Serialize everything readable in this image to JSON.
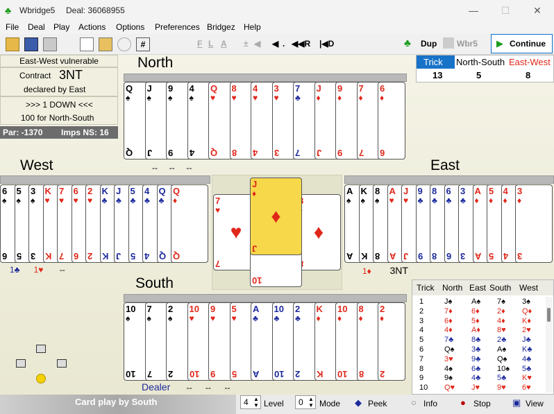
{
  "window": {
    "app_title": "Wbridge5",
    "deal_label": "Deal: 36068955",
    "minimize": "—",
    "maximize": "☐",
    "close": "✕"
  },
  "menu": [
    "File",
    "Deal",
    "Play",
    "Actions",
    "Options",
    "Preferences",
    "Bridgez",
    "Help"
  ],
  "toolbar": {
    "nav": [
      "F",
      "L",
      "A",
      "±",
      "◀",
      ".",
      "◀◀R",
      "|◀D"
    ],
    "dup": "Dup",
    "wbr5": "Wbr5",
    "continue": "Continue"
  },
  "info": {
    "vulnerable": "East-West vulnerable",
    "contract_label": "Contract",
    "contract": "3NT",
    "declared": "declared by East",
    "result": ">>> 1 DOWN <<<",
    "points": "100 for North-South",
    "par": "Par: -1370",
    "imps": "Imps NS: 16"
  },
  "score": {
    "headers": [
      "Trick",
      "North-South",
      "East-West"
    ],
    "values": [
      "13",
      "5",
      "8"
    ],
    "header_colors": [
      "#ffffff",
      "#000000",
      "#e0271a"
    ]
  },
  "directions": {
    "north": "North",
    "south": "South",
    "west": "West",
    "east": "East"
  },
  "auction": {
    "north_below": [
      "--",
      "--",
      "--"
    ],
    "west_below": [
      "1♣",
      "1♥",
      "--"
    ],
    "east_below": [
      "1♦",
      "3NT"
    ],
    "south_below": [
      "Dealer",
      "--",
      "--",
      "--"
    ]
  },
  "hands": {
    "north": [
      {
        "r": "Q",
        "s": "♠",
        "c": "blk"
      },
      {
        "r": "J",
        "s": "♠",
        "c": "blk"
      },
      {
        "r": "9",
        "s": "♠",
        "c": "blk"
      },
      {
        "r": "4",
        "s": "♠",
        "c": "blk"
      },
      {
        "r": "Q",
        "s": "♥",
        "c": "red"
      },
      {
        "r": "8",
        "s": "♥",
        "c": "red"
      },
      {
        "r": "4",
        "s": "♥",
        "c": "red"
      },
      {
        "r": "3",
        "s": "♥",
        "c": "red"
      },
      {
        "r": "7",
        "s": "♣",
        "c": "blu"
      },
      {
        "r": "J",
        "s": "♦",
        "c": "red"
      },
      {
        "r": "9",
        "s": "♦",
        "c": "red"
      },
      {
        "r": "7",
        "s": "♦",
        "c": "red"
      },
      {
        "r": "6",
        "s": "♦",
        "c": "red"
      }
    ],
    "west": [
      {
        "r": "6",
        "s": "♠",
        "c": "blk"
      },
      {
        "r": "5",
        "s": "♠",
        "c": "blk"
      },
      {
        "r": "3",
        "s": "♠",
        "c": "blk"
      },
      {
        "r": "K",
        "s": "♥",
        "c": "red"
      },
      {
        "r": "7",
        "s": "♥",
        "c": "red"
      },
      {
        "r": "6",
        "s": "♥",
        "c": "red"
      },
      {
        "r": "2",
        "s": "♥",
        "c": "red"
      },
      {
        "r": "K",
        "s": "♣",
        "c": "blu"
      },
      {
        "r": "J",
        "s": "♣",
        "c": "blu"
      },
      {
        "r": "5",
        "s": "♣",
        "c": "blu"
      },
      {
        "r": "4",
        "s": "♣",
        "c": "blu"
      },
      {
        "r": "Q",
        "s": "♣",
        "c": "blu"
      },
      {
        "r": "Q",
        "s": "♦",
        "c": "red"
      }
    ],
    "east": [
      {
        "r": "A",
        "s": "♠",
        "c": "blk"
      },
      {
        "r": "K",
        "s": "♠",
        "c": "blk"
      },
      {
        "r": "8",
        "s": "♠",
        "c": "blk"
      },
      {
        "r": "A",
        "s": "♥",
        "c": "red"
      },
      {
        "r": "J",
        "s": "♥",
        "c": "red"
      },
      {
        "r": "9",
        "s": "♣",
        "c": "blu"
      },
      {
        "r": "8",
        "s": "♣",
        "c": "blu"
      },
      {
        "r": "6",
        "s": "♣",
        "c": "blu"
      },
      {
        "r": "3",
        "s": "♣",
        "c": "blu"
      },
      {
        "r": "A",
        "s": "♦",
        "c": "red"
      },
      {
        "r": "5",
        "s": "♦",
        "c": "red"
      },
      {
        "r": "4",
        "s": "♦",
        "c": "red"
      },
      {
        "r": "3",
        "s": "♦",
        "c": "red"
      }
    ],
    "south": [
      {
        "r": "10",
        "s": "♠",
        "c": "blk"
      },
      {
        "r": "7",
        "s": "♠",
        "c": "blk"
      },
      {
        "r": "2",
        "s": "♠",
        "c": "blk"
      },
      {
        "r": "10",
        "s": "♥",
        "c": "red"
      },
      {
        "r": "9",
        "s": "♥",
        "c": "red"
      },
      {
        "r": "5",
        "s": "♥",
        "c": "red"
      },
      {
        "r": "A",
        "s": "♣",
        "c": "blu"
      },
      {
        "r": "10",
        "s": "♣",
        "c": "blu"
      },
      {
        "r": "2",
        "s": "♣",
        "c": "blu"
      },
      {
        "r": "K",
        "s": "♦",
        "c": "red"
      },
      {
        "r": "10",
        "s": "♦",
        "c": "red"
      },
      {
        "r": "8",
        "s": "♦",
        "c": "red"
      },
      {
        "r": "2",
        "s": "♦",
        "c": "red"
      }
    ]
  },
  "trick_cards": [
    {
      "r": "J",
      "s": "♦",
      "c": "red",
      "who": "north"
    },
    {
      "r": "7",
      "s": "♥",
      "c": "red",
      "who": "west"
    },
    {
      "r": "8",
      "s": "♦",
      "c": "red",
      "who": "east"
    },
    {
      "r": "10",
      "s": "♥",
      "c": "red",
      "who": "south"
    }
  ],
  "history": {
    "headers": [
      "Trick",
      "North",
      "East",
      "South",
      "West"
    ],
    "rows": [
      [
        "1",
        "J♠",
        "A♠",
        "7♠",
        "3♠"
      ],
      [
        "2",
        "7♦",
        "6♦",
        "2♦",
        "Q♦"
      ],
      [
        "3",
        "6♦",
        "5♦",
        "4♦",
        "K♦"
      ],
      [
        "4",
        "4♦",
        "A♦",
        "8♥",
        "2♥"
      ],
      [
        "5",
        "7♣",
        "8♣",
        "2♣",
        "J♣"
      ],
      [
        "6",
        "Q♠",
        "3♣",
        "A♠",
        "K♣"
      ],
      [
        "7",
        "3♥",
        "9♣",
        "Q♠",
        "4♣"
      ],
      [
        "8",
        "4♠",
        "6♣",
        "10♠",
        "5♣"
      ],
      [
        "9",
        "9♠",
        "4♣",
        "5♣",
        "K♥"
      ],
      [
        "10",
        "Q♥",
        "J♥",
        "9♥",
        "6♥"
      ]
    ]
  },
  "status": {
    "card_play": "Card play by South",
    "level_value": "4",
    "level_label": "Level",
    "mode_value": "0",
    "mode_label": "Mode",
    "peek": "Peek",
    "info": "Info",
    "stop": "Stop",
    "view": "View"
  }
}
